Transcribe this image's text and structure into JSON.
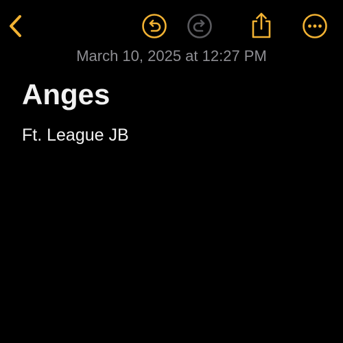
{
  "toolbar": {
    "back_icon": "chevron-left-icon",
    "undo_icon": "undo-icon",
    "redo_icon": "redo-icon",
    "share_icon": "share-icon",
    "more_icon": "ellipsis-circle-icon",
    "redo_enabled": false
  },
  "note": {
    "date": "March 10, 2025 at 12:27 PM",
    "title": "Anges",
    "body": "Ft. League JB"
  },
  "colors": {
    "accent": "#f2b233",
    "disabled": "#5a5a5e",
    "background": "#000000",
    "date_text": "#8e8e93",
    "text": "#f2f2f2"
  }
}
